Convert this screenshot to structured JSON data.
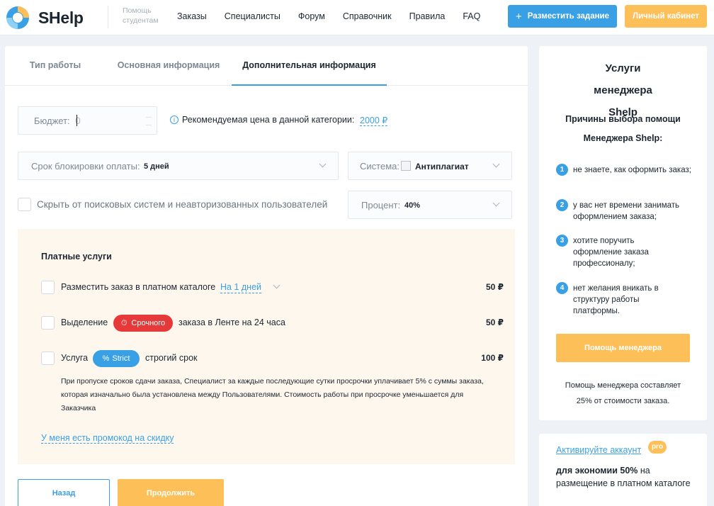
{
  "header": {
    "logo_text": "SHelp",
    "tagline": "Помощь студентам",
    "nav": [
      "Заказы",
      "Специалисты",
      "Форум",
      "Справочник",
      "Правила",
      "FAQ"
    ],
    "post_task_label": "Разместить задание",
    "cabinet_label": "Личный кабинет"
  },
  "tabs": [
    {
      "label": "Тип работы"
    },
    {
      "label": "Основная информация"
    },
    {
      "label": "Дополнительная информация"
    }
  ],
  "form": {
    "budget_label": "Бюджет:",
    "budget_placeholder": "0",
    "recommend_text": "Рекомендуемая цена в данной категории:",
    "recommend_price": "2000 ₽",
    "lock_label": "Срок блокировки оплаты:",
    "lock_value": "5 дней",
    "system_label": "Система:",
    "system_value": "Антиплагиат",
    "hide_label": "Скрыть от поисковых систем и неавторизованных пользователей",
    "percent_label": "Процент:",
    "percent_value": "40%"
  },
  "paid": {
    "title": "Платные услуги",
    "catalog_text": "Разместить заказ в платном каталоге",
    "catalog_period": "На 1 дней",
    "catalog_price": "50 ₽",
    "highlight_prefix": "Выделение",
    "highlight_badge": "Срочного",
    "highlight_suffix": "заказа в Ленте на 24 часа",
    "highlight_price": "50 ₽",
    "strict_prefix": "Услуга",
    "strict_badge": "Strict",
    "strict_suffix": "строгий срок",
    "strict_price": "100 ₽",
    "strict_note": "При пропуске сроков сдачи заказа, Специалист за каждые последующие сутки просрочки уплачивает 5% с суммы заказа, которая изначально была установлена между Пользователями. Стоимость работы при просрочке уменьшается для Заказчика",
    "promo_link": "У меня есть промокод на скидку"
  },
  "actions": {
    "back_label": "Назад",
    "next_label": "Продолжить"
  },
  "sidebar": {
    "title": "Услуги менеджера Shelp",
    "subtitle": "Причины выбора помощи Менеджера Shelp:",
    "reasons": [
      {
        "num": "1",
        "text": "не знаете, как оформить заказ;"
      },
      {
        "num": "2",
        "text": "у вас нет времени занимать оформлением заказа;"
      },
      {
        "num": "3",
        "text": "хотите поручить оформление заказа профессионалу;"
      },
      {
        "num": "4",
        "text": "нет желания вникать в структуру работы платформы."
      }
    ],
    "button_label": "Помощь менеджера",
    "footer": "Помощь менеджера составляет 25% от стоимости заказа."
  },
  "promo_card": {
    "activate_link": "Активируйте аккаунт",
    "pro_badge": "pro",
    "bold_text": "для экономии 50%",
    "rest_text": "на размещение в платном каталоге"
  },
  "colors": {
    "accent": "#3aa0e6",
    "cta": "#fdbf57",
    "urgent": "#e63a3a",
    "paid_bg": "#fef7ee"
  }
}
